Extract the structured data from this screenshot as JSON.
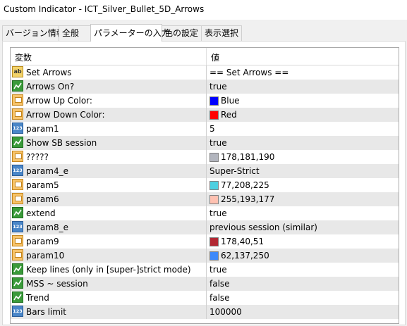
{
  "window": {
    "title": "Custom Indicator - ICT_Silver_Bullet_5D_Arrows"
  },
  "tabs": [
    {
      "label": "バージョン情報"
    },
    {
      "label": "全般"
    },
    {
      "label": "パラメーターの入力",
      "active": true
    },
    {
      "label": "色の設定"
    },
    {
      "label": "表示選択"
    }
  ],
  "table": {
    "columns": {
      "name": "変数",
      "value": "値"
    },
    "rows": [
      {
        "icon": "string-icon",
        "name": "Set Arrows",
        "value": "== Set Arrows =="
      },
      {
        "icon": "bool-icon",
        "name": "Arrows On?",
        "value": "true"
      },
      {
        "icon": "color-icon",
        "name": "Arrow Up Color:",
        "value": "Blue",
        "swatch": "#0000ff"
      },
      {
        "icon": "color-icon",
        "name": "Arrow Down Color:",
        "value": "Red",
        "swatch": "#ff0000"
      },
      {
        "icon": "int-icon",
        "name": "param1",
        "value": "5"
      },
      {
        "icon": "bool-icon",
        "name": "Show SB session",
        "value": "true"
      },
      {
        "icon": "color-icon",
        "name": "?????",
        "value": "178,181,190",
        "swatch": "#b2b5be"
      },
      {
        "icon": "int-icon",
        "name": "param4_e",
        "value": "Super-Strict"
      },
      {
        "icon": "color-icon",
        "name": "param5",
        "value": "77,208,225",
        "swatch": "#4dd0e1"
      },
      {
        "icon": "color-icon",
        "name": "param6",
        "value": "255,193,177",
        "swatch": "#ffc1b1"
      },
      {
        "icon": "bool-icon",
        "name": "extend",
        "value": "true"
      },
      {
        "icon": "int-icon",
        "name": "param8_e",
        "value": "previous session (similar)"
      },
      {
        "icon": "color-icon",
        "name": "param9",
        "value": "178,40,51",
        "swatch": "#b22833"
      },
      {
        "icon": "color-icon",
        "name": "param10",
        "value": "62,137,250",
        "swatch": "#3e89fa"
      },
      {
        "icon": "bool-icon",
        "name": "Keep lines (only in [super-]strict mode)",
        "value": "true"
      },
      {
        "icon": "bool-icon",
        "name": "MSS ~ session",
        "value": "false"
      },
      {
        "icon": "bool-icon",
        "name": "Trend",
        "value": "false"
      },
      {
        "icon": "int-icon",
        "name": "Bars limit",
        "value": "100000"
      }
    ]
  }
}
